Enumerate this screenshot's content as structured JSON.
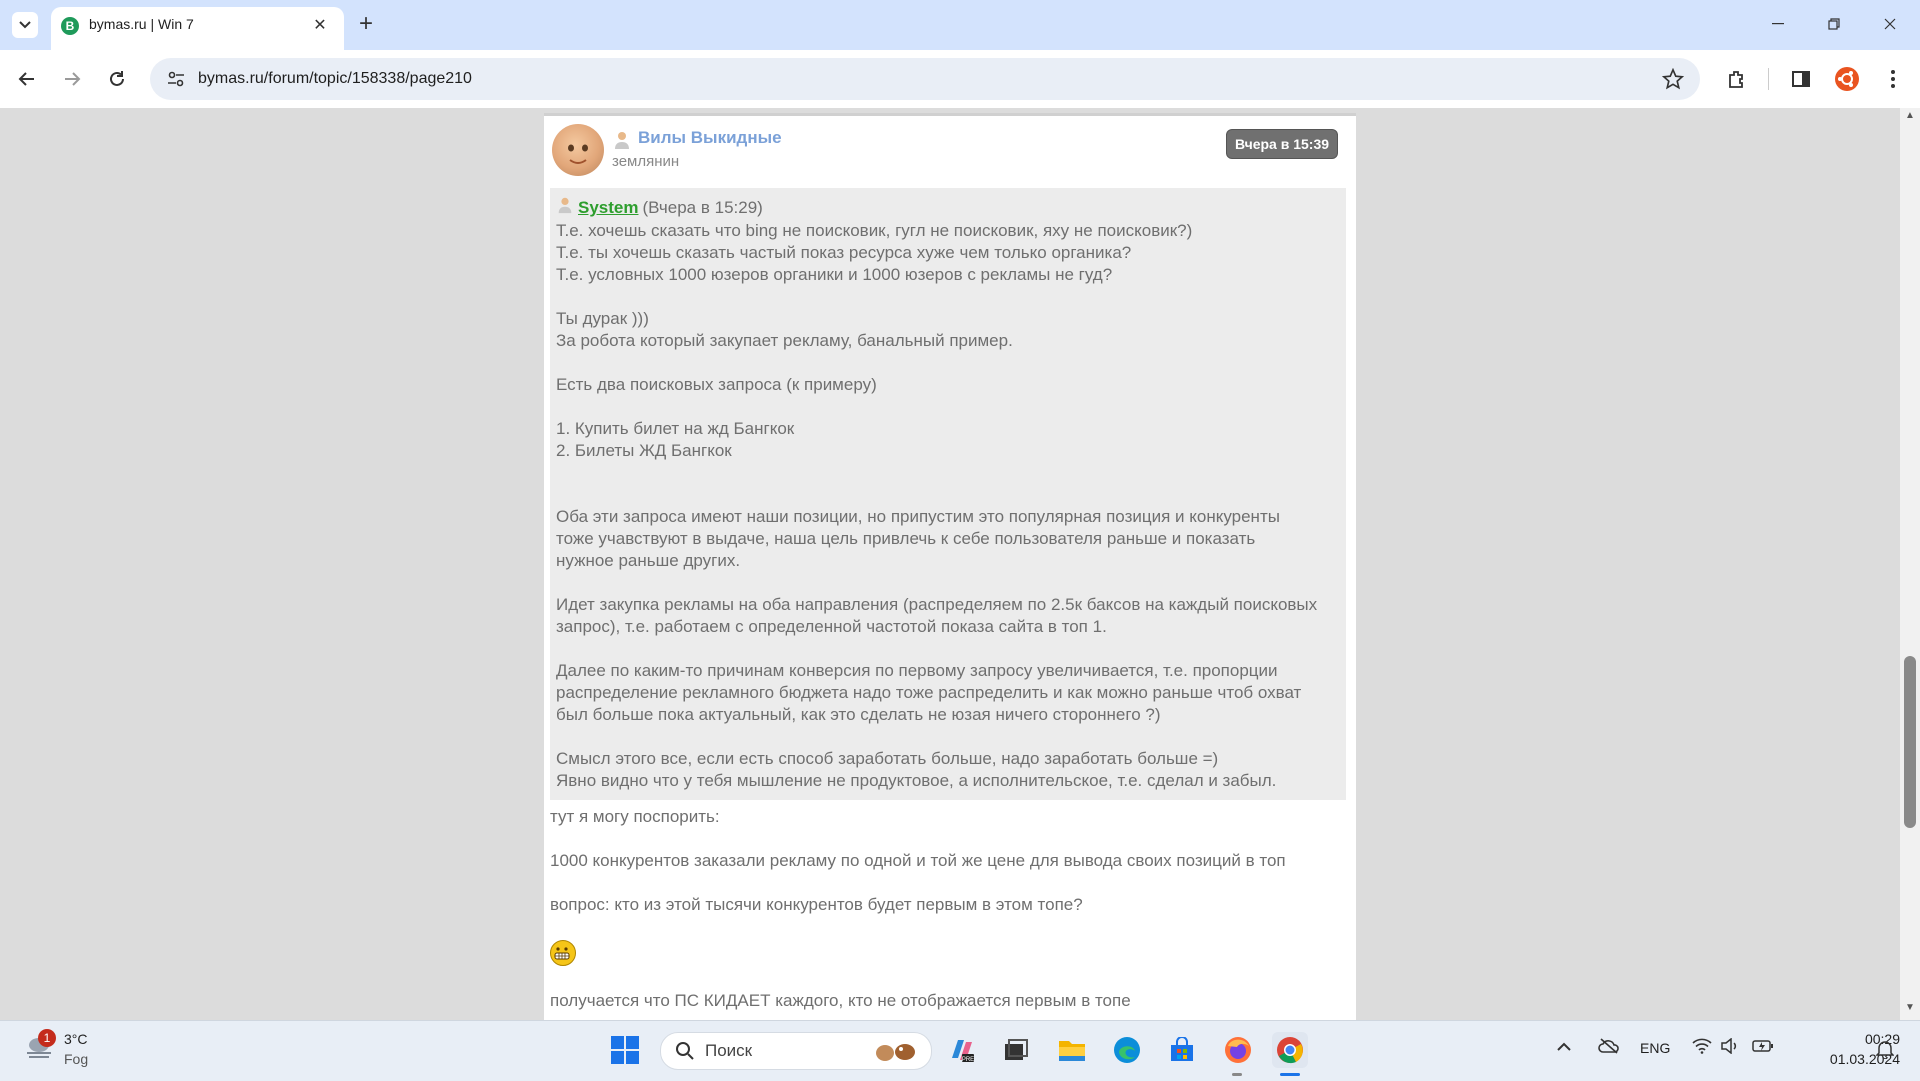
{
  "browser": {
    "tab_title": "bymas.ru | Win 7",
    "tab_favicon_letter": "B",
    "url": "bymas.ru/forum/topic/158338/page210",
    "icons": [
      "tab-list-icon",
      "close-icon",
      "plus-icon",
      "back-icon",
      "forward-icon",
      "reload-icon",
      "site-info-icon",
      "star-icon",
      "extensions-icon",
      "sidebar-icon",
      "profile-icon",
      "menu-icon",
      "minimize-icon",
      "restore-icon",
      "window-close-icon"
    ]
  },
  "post": {
    "author": "Вилы Выкидные",
    "rank": "землянин",
    "date": "Вчера в 15:39",
    "quote": {
      "author": "System",
      "date": "(Вчера в 15:29)",
      "lines": [
        "Т.е. хочешь сказать что bing не поисковик, гугл не поисковик, яху не поисковик?)",
        "Т.е. ты хочешь сказать частый показ ресурса хуже чем только органика?",
        "Т.е. условных 1000 юзеров органики и 1000 юзеров с рекламы не гуд?",
        "",
        "Ты дурак )))",
        "За робота который закупает рекламу, банальный пример.",
        "",
        "Есть два поисковых запроса (к примеру)",
        "",
        "1. Купить билет на жд Бангкок",
        "2. Билеты ЖД Бангкок",
        "",
        "",
        "Оба эти запроса имеют наши позиции, но припустим это популярная позиция и конкуренты",
        "тоже учавствуют в выдаче, наша цель привлечь к себе пользователя раньше и показать",
        "нужное раньше других.",
        "",
        "Идет закупка рекламы на оба направления (распределяем по 2.5к баксов на каждый поисковых",
        "запрос), т.е. работаем с определенной частотой показа сайта в топ 1.",
        "",
        "Далее по каким-то причинам конверсия по первому запросу увеличивается, т.е. пропорции",
        "распределение рекламного бюджета надо тоже распределить и как можно раньше чтоб охват",
        "был больше пока актуальный, как это сделать не юзая ничего стороннего ?)",
        "",
        "Смысл этого все, если есть способ заработать больше, надо заработать больше =)",
        "Явно видно что у тебя мышление не продуктовое, а исполнительское, т.е. сделал и забыл."
      ]
    },
    "reply": {
      "line1": "тут я могу поспорить:",
      "line2": "1000 конкурентов заказали рекламу по одной и той же цене для вывода своих позиций в топ",
      "line3": "вопрос: кто из этой тысячи конкурентов будет первым в этом топе?",
      "emoji": "grimacing-emoji",
      "line4": "получается что ПС КИДАЕТ каждого, кто не отображается первым в топе"
    }
  },
  "taskbar": {
    "weather_badge": "1",
    "weather_temp": "3°C",
    "weather_desc": "Fog",
    "search_placeholder": "Поиск",
    "language": "ENG",
    "time": "00:29",
    "date": "01.03.2024",
    "apps": [
      "copilot-icon",
      "task-view-icon",
      "file-explorer-icon",
      "edge-icon",
      "store-icon",
      "firefox-icon",
      "chrome-icon"
    ]
  },
  "colors": {
    "tabbar": "#d3e3fd",
    "author_name": "#7ba1d8",
    "quote_author": "#2e9e2e",
    "quote_bg": "#ececec",
    "date_badge": "#707070"
  }
}
